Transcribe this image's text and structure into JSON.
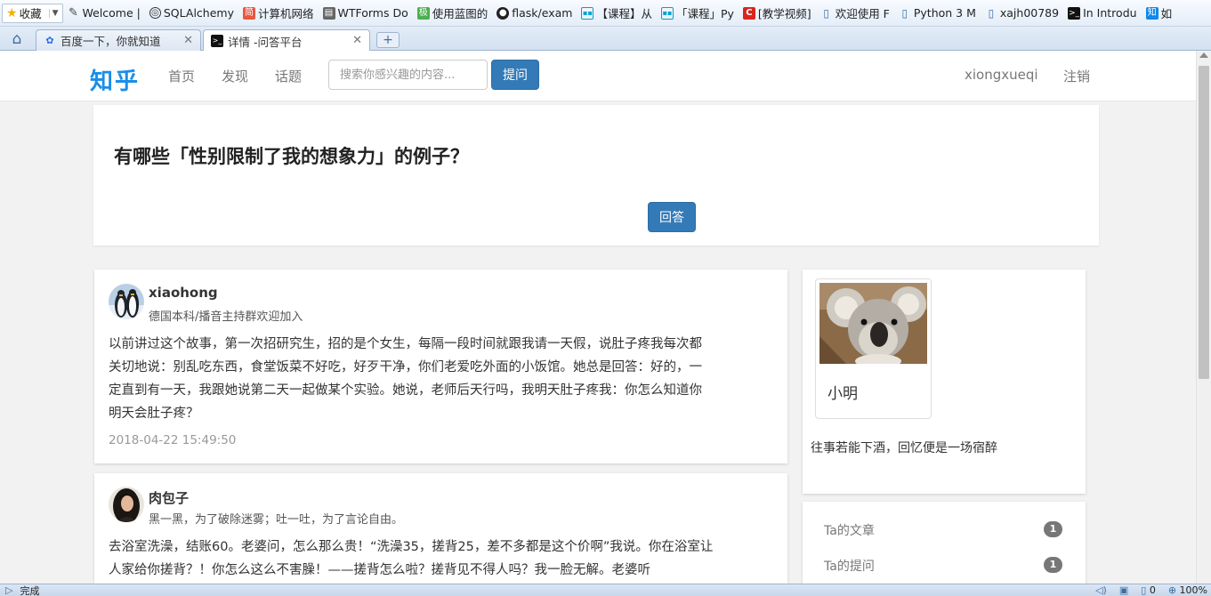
{
  "browser": {
    "favorites_label": "收藏",
    "bookmarks": [
      {
        "label": "Welcome |",
        "icon": "feather-icon"
      },
      {
        "label": "SQLAlchemy",
        "icon": "sqlalchemy-icon"
      },
      {
        "label": "计算机网络",
        "icon": "jianshu-icon"
      },
      {
        "label": "WTForms Do",
        "icon": "docs-icon"
      },
      {
        "label": "使用蓝图的",
        "icon": "green-book-icon"
      },
      {
        "label": "flask/exam",
        "icon": "github-icon"
      },
      {
        "label": "【课程】从",
        "icon": "bilibili-icon"
      },
      {
        "label": "「课程」Py",
        "icon": "bilibili-icon"
      },
      {
        "label": "[教学视频]",
        "icon": "red-c-icon"
      },
      {
        "label": "欢迎使用 F",
        "icon": "page-icon"
      },
      {
        "label": "Python 3 M",
        "icon": "page-icon"
      },
      {
        "label": "xajh00789",
        "icon": "page-icon"
      },
      {
        "label": "In Introdu",
        "icon": "terminal-icon"
      },
      {
        "label": "如",
        "icon": "zhihu-icon"
      }
    ],
    "tabs": [
      {
        "label": "百度一下，你就知道",
        "icon": "paw-icon"
      },
      {
        "label": "详情 -问答平台",
        "icon": "terminal-icon"
      }
    ],
    "status_text": "完成",
    "status_count": "0",
    "zoom": "100%"
  },
  "nav": {
    "logo": "知乎",
    "links": [
      "首页",
      "发现",
      "话题"
    ],
    "search_placeholder": "搜索你感兴趣的内容...",
    "ask_label": "提问",
    "username": "xiongxueqi",
    "logout_label": "注销"
  },
  "question": {
    "title": "有哪些「性别限制了我的想象力」的例子？",
    "answer_button": "回答"
  },
  "answers": [
    {
      "author": "xiaohong",
      "bio": "德国本科/播音主持群欢迎加入",
      "text": "以前讲过这个故事，第一次招研究生，招的是个女生，每隔一段时间就跟我请一天假，说肚子疼我每次都关切地说：别乱吃东西，食堂饭菜不好吃，好歹干净，你们老爱吃外面的小饭馆。她总是回答：好的，一定直到有一天，我跟她说第二天一起做某个实验。她说，老师后天行吗，我明天肚子疼我：你怎么知道你明天会肚子疼？",
      "time": "2018-04-22 15:49:50"
    },
    {
      "author": "肉包子",
      "bio": "黑一黑，为了破除迷雾；吐一吐，为了言论自由。",
      "text": "去浴室洗澡，结账60。老婆问，怎么那么贵！“洗澡35，搓背25，差不多都是这个价啊”我说。你在浴室让人家给你搓背？！你怎么这么不害臊！——搓背怎么啦？搓背见不得人吗？我一脸无解。老婆听",
      "time": ""
    }
  ],
  "profile": {
    "name": "小明",
    "motto": "往事若能下酒，回忆便是一场宿醉"
  },
  "stats": [
    {
      "label": "Ta的文章",
      "count": "1"
    },
    {
      "label": "Ta的提问",
      "count": "1"
    }
  ],
  "colors": {
    "brand": "#1a8ee8",
    "primary_button": "#337ab7",
    "badge": "#777777"
  }
}
